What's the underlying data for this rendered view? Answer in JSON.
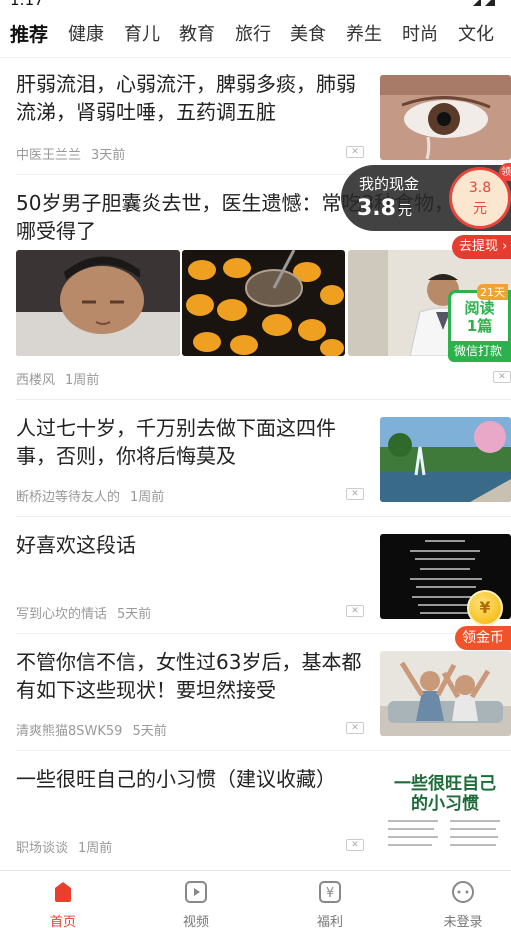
{
  "status": {
    "time": "1:17"
  },
  "tabs": [
    {
      "label": "推荐"
    },
    {
      "label": "健康"
    },
    {
      "label": "育儿"
    },
    {
      "label": "教育"
    },
    {
      "label": "旅行"
    },
    {
      "label": "美食"
    },
    {
      "label": "养生"
    },
    {
      "label": "时尚"
    },
    {
      "label": "文化"
    }
  ],
  "articles": [
    {
      "title": "肝弱流泪，心弱流汗，脾弱多痰，肺弱流涕，肾弱吐唾，五药调五脏",
      "source": "中医王兰兰",
      "time": "3天前"
    },
    {
      "title": "50岁男子胆囊炎去世，医生遗憾：常吃3种食物，胆囊哪受得了",
      "source": "西楼风",
      "time": "1周前"
    },
    {
      "title": "人过七十岁，千万别去做下面这四件事，否则，你将后悔莫及",
      "source": "断桥边等待友人的",
      "time": "1周前"
    },
    {
      "title": "好喜欢这段话",
      "source": "写到心坎的情话",
      "time": "5天前"
    },
    {
      "title": "不管你信不信，女性过63岁后，基本都有如下这些现状！要坦然接受",
      "source": "清爽熊猫8SWK59",
      "time": "5天前"
    },
    {
      "title": "一些很旺自己的小习惯（建议收藏）",
      "source": "职场谈谈",
      "time": "1周前"
    }
  ],
  "thumb6_text": "一些很旺自己的小习惯",
  "cash_widget": {
    "label": "我的现金",
    "amount": "3.8",
    "unit": "元",
    "coin_amount": "3.8",
    "coin_unit": "元",
    "corner": "领"
  },
  "withdraw_label": "去提现",
  "read_widget": {
    "days": "21天",
    "line1": "阅读",
    "line2": "1篇",
    "bottom": "微信打款"
  },
  "gold_widget": {
    "label": "领金币",
    "coin": "¥"
  },
  "bottom_nav": [
    {
      "label": "首页",
      "icon": "home-icon"
    },
    {
      "label": "视频",
      "icon": "video-icon"
    },
    {
      "label": "福利",
      "icon": "welfare-icon"
    },
    {
      "label": "未登录",
      "icon": "profile-icon"
    }
  ],
  "colors": {
    "accent": "#e8402c",
    "green": "#2bb24c",
    "meta": "#999999"
  }
}
